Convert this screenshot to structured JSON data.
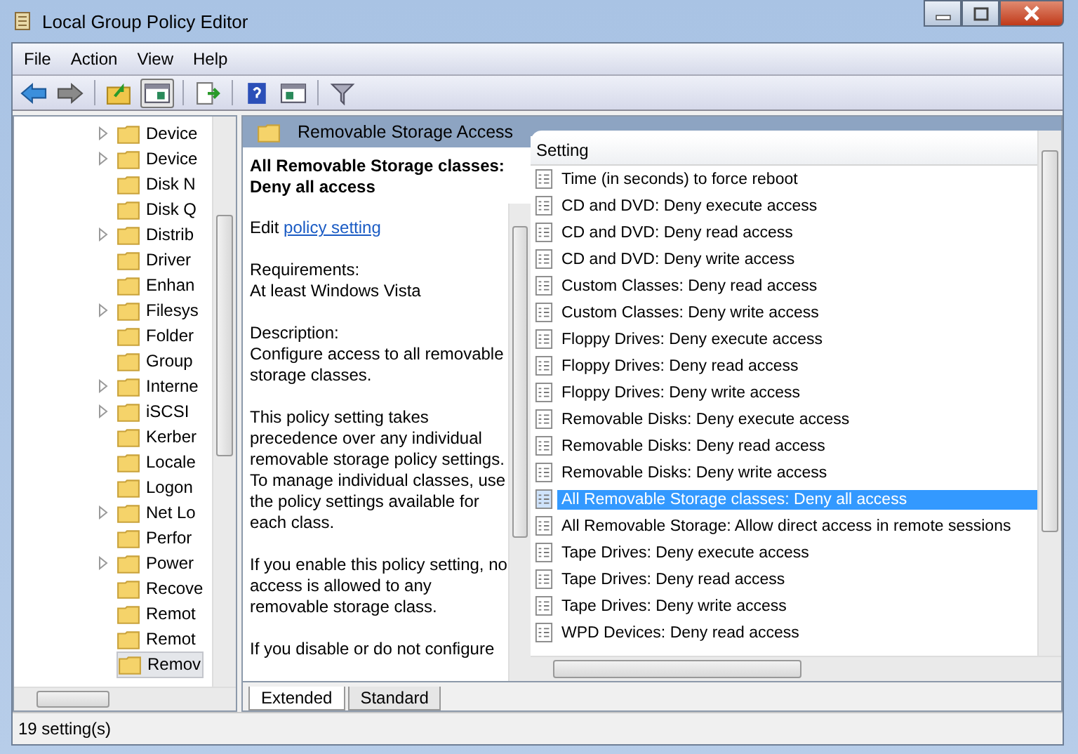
{
  "window": {
    "title": "Local Group Policy Editor"
  },
  "menu": [
    "File",
    "Action",
    "View",
    "Help"
  ],
  "tree": {
    "items": [
      {
        "label": "Device",
        "expandable": true,
        "selected": false
      },
      {
        "label": "Device",
        "expandable": true,
        "selected": false
      },
      {
        "label": "Disk N",
        "expandable": false,
        "selected": false
      },
      {
        "label": "Disk Q",
        "expandable": false,
        "selected": false
      },
      {
        "label": "Distrib",
        "expandable": true,
        "selected": false
      },
      {
        "label": "Driver",
        "expandable": false,
        "selected": false
      },
      {
        "label": "Enhan",
        "expandable": false,
        "selected": false
      },
      {
        "label": "Filesys",
        "expandable": true,
        "selected": false
      },
      {
        "label": "Folder",
        "expandable": false,
        "selected": false
      },
      {
        "label": "Group",
        "expandable": false,
        "selected": false
      },
      {
        "label": "Interne",
        "expandable": true,
        "selected": false
      },
      {
        "label": "iSCSI",
        "expandable": true,
        "selected": false
      },
      {
        "label": "Kerber",
        "expandable": false,
        "selected": false
      },
      {
        "label": "Locale",
        "expandable": false,
        "selected": false
      },
      {
        "label": "Logon",
        "expandable": false,
        "selected": false
      },
      {
        "label": "Net Lo",
        "expandable": true,
        "selected": false
      },
      {
        "label": "Perfor",
        "expandable": false,
        "selected": false
      },
      {
        "label": "Power",
        "expandable": true,
        "selected": false
      },
      {
        "label": "Recove",
        "expandable": false,
        "selected": false
      },
      {
        "label": "Remot",
        "expandable": false,
        "selected": false
      },
      {
        "label": "Remot",
        "expandable": false,
        "selected": false
      },
      {
        "label": "Remov",
        "expandable": false,
        "selected": true
      }
    ]
  },
  "header": {
    "title": "Removable Storage Access"
  },
  "description": {
    "title": "All Removable Storage classes: Deny all access",
    "edit_prefix": "Edit",
    "edit_link": "policy setting",
    "paragraphs": [
      [
        "Requirements:",
        "At least Windows Vista"
      ],
      [
        "Description:",
        "Configure access to all removable storage classes."
      ],
      [
        "This policy setting takes precedence over any individual removable storage policy settings. To manage individual classes, use the policy settings available for each class."
      ],
      [
        "If you enable this policy setting, no access is allowed to any removable storage class."
      ],
      [
        "If you disable or do not configure"
      ]
    ]
  },
  "list": {
    "column": "Setting",
    "rows": [
      {
        "label": "Time (in seconds) to force reboot",
        "selected": false
      },
      {
        "label": "CD and DVD: Deny execute access",
        "selected": false
      },
      {
        "label": "CD and DVD: Deny read access",
        "selected": false
      },
      {
        "label": "CD and DVD: Deny write access",
        "selected": false
      },
      {
        "label": "Custom Classes: Deny read access",
        "selected": false
      },
      {
        "label": "Custom Classes: Deny write access",
        "selected": false
      },
      {
        "label": "Floppy Drives: Deny execute access",
        "selected": false
      },
      {
        "label": "Floppy Drives: Deny read access",
        "selected": false
      },
      {
        "label": "Floppy Drives: Deny write access",
        "selected": false
      },
      {
        "label": "Removable Disks: Deny execute access",
        "selected": false
      },
      {
        "label": "Removable Disks: Deny read access",
        "selected": false
      },
      {
        "label": "Removable Disks: Deny write access",
        "selected": false
      },
      {
        "label": "All Removable Storage classes: Deny all access",
        "selected": true
      },
      {
        "label": "All Removable Storage: Allow direct access in remote sessions",
        "selected": false
      },
      {
        "label": "Tape Drives: Deny execute access",
        "selected": false
      },
      {
        "label": "Tape Drives: Deny read access",
        "selected": false
      },
      {
        "label": "Tape Drives: Deny write access",
        "selected": false
      },
      {
        "label": "WPD Devices: Deny read access",
        "selected": false
      }
    ]
  },
  "tabs": [
    {
      "label": "Extended",
      "selected": true
    },
    {
      "label": "Standard",
      "selected": false
    }
  ],
  "status_bar": "19 setting(s)"
}
